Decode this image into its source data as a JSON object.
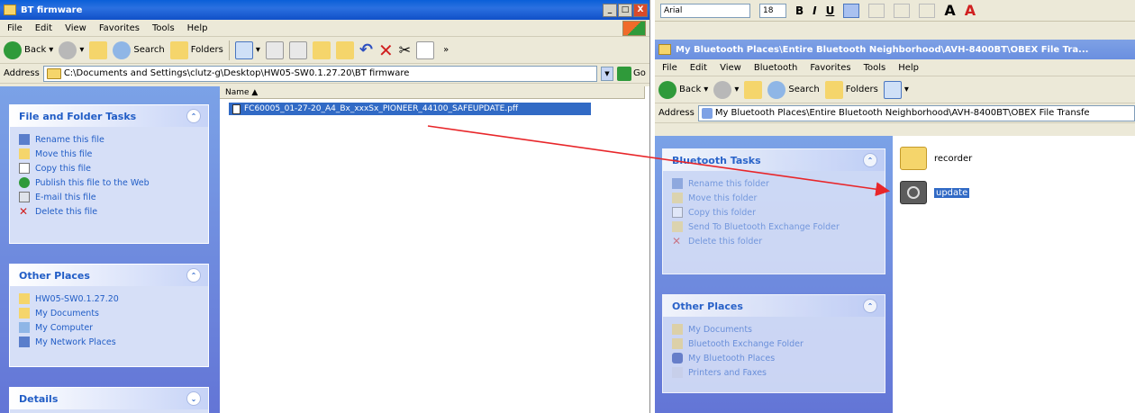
{
  "left_window": {
    "title": "BT firmware",
    "controls": {
      "min": "_",
      "max": "□",
      "close": "X"
    },
    "menu": [
      "File",
      "Edit",
      "View",
      "Favorites",
      "Tools",
      "Help"
    ],
    "toolbar": {
      "back": "Back",
      "search": "Search",
      "folders": "Folders"
    },
    "address_label": "Address",
    "address": "C:\\Documents and Settings\\clutz-g\\Desktop\\HW05-SW0.1.27.20\\BT firmware",
    "go": "Go",
    "file_tasks": {
      "title": "File and Folder Tasks",
      "items": [
        "Rename this file",
        "Move this file",
        "Copy this file",
        "Publish this file to the Web",
        "E-mail this file",
        "Delete this file"
      ]
    },
    "other_places": {
      "title": "Other Places",
      "items": [
        "HW05-SW0.1.27.20",
        "My Documents",
        "My Computer",
        "My Network Places"
      ]
    },
    "details": {
      "title": "Details"
    },
    "column_name": "Name",
    "selected_file": "FC60005_01-27-20_A4_Bx_xxxSx_PIONEER_44100_SAFEUPDATE.pff"
  },
  "right_window": {
    "format_bar": {
      "font": "Arial",
      "size": "18",
      "bold": "B",
      "italic": "I",
      "underline": "U"
    },
    "title": "My Bluetooth Places\\Entire Bluetooth Neighborhood\\AVH-8400BT\\OBEX File Tra...",
    "menu": [
      "File",
      "Edit",
      "View",
      "Bluetooth",
      "Favorites",
      "Tools",
      "Help"
    ],
    "toolbar": {
      "back": "Back",
      "search": "Search",
      "folders": "Folders"
    },
    "address_label": "Address",
    "address": "My Bluetooth Places\\Entire Bluetooth Neighborhood\\AVH-8400BT\\OBEX File Transfe",
    "bt_tasks": {
      "title": "Bluetooth Tasks",
      "items": [
        "Rename this folder",
        "Move this folder",
        "Copy this folder",
        "Send To Bluetooth Exchange Folder",
        "Delete this folder"
      ]
    },
    "other_places": {
      "title": "Other Places",
      "items": [
        "My Documents",
        "Bluetooth Exchange Folder",
        "My Bluetooth Places",
        "Printers and Faxes"
      ]
    },
    "folders": [
      "recorder",
      "update"
    ]
  },
  "colors": {
    "arrow": "#e8262a",
    "selection": "#316ac5",
    "task_link": "#215dc6"
  }
}
